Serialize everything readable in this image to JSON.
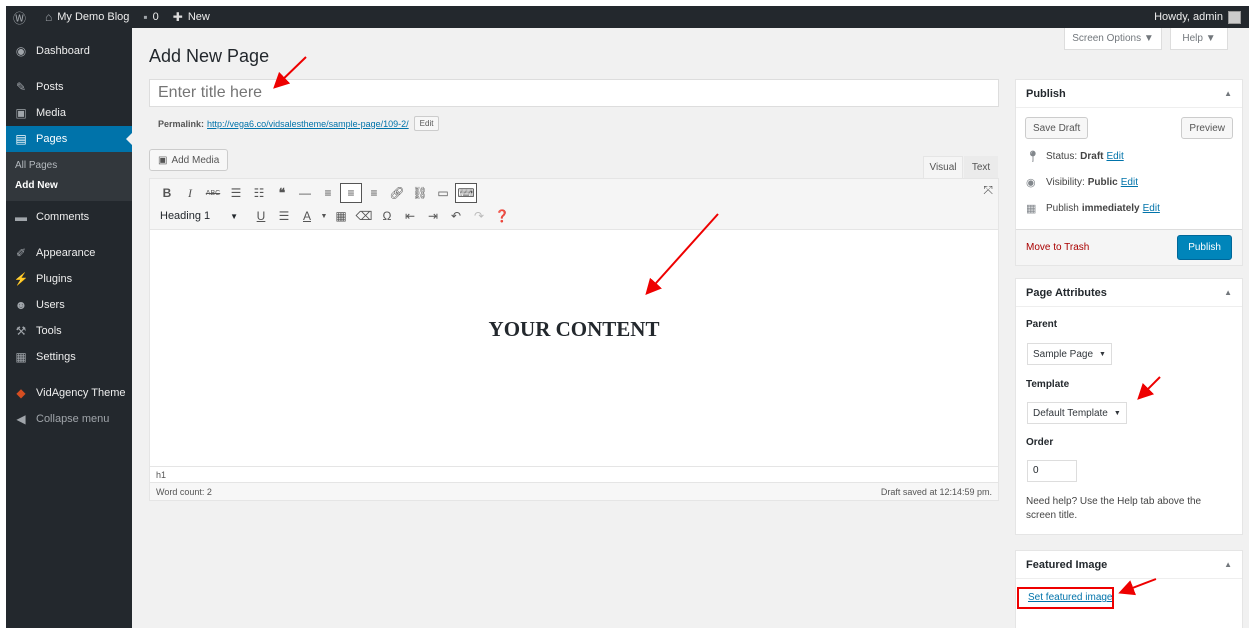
{
  "adminbar": {
    "site_name": "My Demo Blog",
    "comments_count": "0",
    "new_label": "New",
    "howdy": "Howdy, admin"
  },
  "sidebar": {
    "items": [
      {
        "label": "Dashboard",
        "icon": "dashboard-icon"
      },
      {
        "label": "Posts",
        "icon": "pin-icon"
      },
      {
        "label": "Media",
        "icon": "media-icon"
      },
      {
        "label": "Pages",
        "icon": "pages-icon"
      },
      {
        "label": "Comments",
        "icon": "comment-icon"
      },
      {
        "label": "Appearance",
        "icon": "brush-icon"
      },
      {
        "label": "Plugins",
        "icon": "plugin-icon"
      },
      {
        "label": "Users",
        "icon": "users-icon"
      },
      {
        "label": "Tools",
        "icon": "wrench-icon"
      },
      {
        "label": "Settings",
        "icon": "settings-icon"
      },
      {
        "label": "VidAgency Theme",
        "icon": "theme-icon"
      },
      {
        "label": "Collapse menu",
        "icon": "collapse-icon"
      }
    ],
    "submenu": [
      "All Pages",
      "Add New"
    ]
  },
  "screen_options": "Screen Options ▼",
  "help": "Help ▼",
  "page_title": "Add New Page",
  "title_placeholder": "Enter title here",
  "permalink": {
    "label": "Permalink:",
    "url": "http://vega6.co/vidsalestheme/sample-page/109-2/",
    "edit_label": "Edit"
  },
  "add_media": "Add Media",
  "editor_tabs": {
    "visual": "Visual",
    "text": "Text"
  },
  "format_select": "Heading 1",
  "content_heading": "YOUR CONTENT",
  "path": "h1",
  "word_count": "Word count: 2",
  "draft_saved": "Draft saved at 12:14:59 pm.",
  "publish_box": {
    "title": "Publish",
    "save_draft": "Save Draft",
    "preview": "Preview",
    "status_label": "Status:",
    "status_value": "Draft",
    "visibility_label": "Visibility:",
    "visibility_value": "Public",
    "publish_label": "Publish",
    "publish_value": "immediately",
    "edit": "Edit",
    "move_to_trash": "Move to Trash",
    "publish_button": "Publish"
  },
  "attributes_box": {
    "title": "Page Attributes",
    "parent_label": "Parent",
    "parent_value": "Sample Page",
    "template_label": "Template",
    "template_value": "Default Template",
    "order_label": "Order",
    "order_value": "0",
    "help_text": "Need help? Use the Help tab above the screen title."
  },
  "featured_box": {
    "title": "Featured Image",
    "link": "Set featured image"
  },
  "colors": {
    "accent": "#0073aa",
    "adminbar": "#23282d",
    "publish": "#0085ba",
    "annotation": "#ee0000"
  }
}
